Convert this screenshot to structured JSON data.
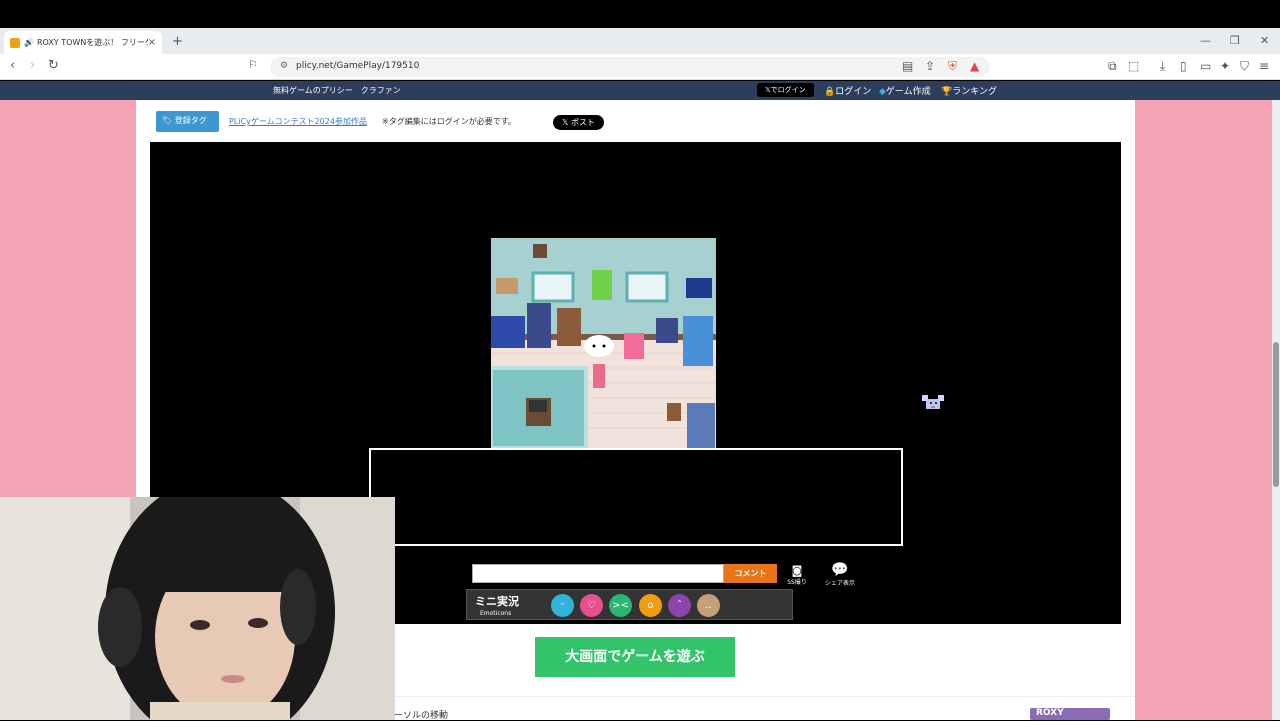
{
  "browser": {
    "tab_title": "ROXY TOWNを遊ぶ！ フリーゲ",
    "tab_close": "×",
    "new_tab": "+",
    "url": "plicy.net/GamePlay/179510"
  },
  "site": {
    "title": "無料ゲームのプリシー　クラファン",
    "x_login": "𝕏でログイン",
    "login": "ログイン",
    "create_game": "ゲーム作成",
    "ranking": "ランキング"
  },
  "tags": {
    "button": "登録タグ",
    "link": "PLiCyゲームコンテスト2024参加作品",
    "note": "※タグ編集にはログインが必要です。",
    "x_post": "𝕏 ポスト"
  },
  "comment": {
    "button": "コメント",
    "ss": "SS撮り",
    "share": "シェア表示"
  },
  "emoticons": {
    "title": "ミニ実況",
    "subtitle": "Emoticons",
    "items": [
      {
        "icon": "smile-emo-icon",
        "color": "#2fb3d6"
      },
      {
        "icon": "heart-emo-icon",
        "color": "#e84f8c"
      },
      {
        "icon": "laugh-emo-icon",
        "color": "#2bb673"
      },
      {
        "icon": "surprise-emo-icon",
        "color": "#f39c12"
      },
      {
        "icon": "sad-emo-icon",
        "color": "#8e44ad"
      },
      {
        "icon": "neutral-emo-icon",
        "color": "#c4a07a"
      }
    ]
  },
  "play_big": "大画面でゲームを遊ぶ",
  "footer": {
    "cursor_move": "ーソルの移動",
    "logo": "ROXY"
  },
  "colors": {
    "accent_orange": "#e8751a",
    "play_green": "#33c46a",
    "page_pink": "#f4a3b5",
    "site_navy": "#2c3e5c"
  }
}
